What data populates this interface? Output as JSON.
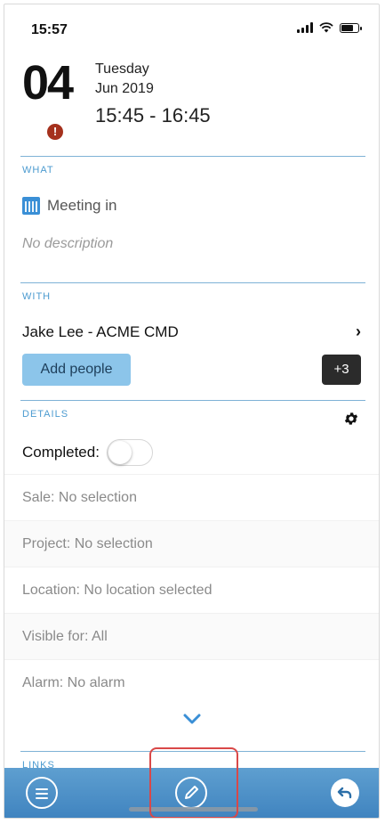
{
  "status_bar": {
    "time": "15:57"
  },
  "event": {
    "day": "04",
    "weekday": "Tuesday",
    "month_year": "Jun 2019",
    "time_range": "15:45 - 16:45",
    "alert_symbol": "!"
  },
  "what": {
    "label": "WHAT",
    "icon": "calendar-icon",
    "title": "Meeting in",
    "description": "No description"
  },
  "with": {
    "label": "WITH",
    "contact": "Jake Lee - ACME CMD",
    "chevron": "›",
    "add_people_label": "Add people",
    "extra_count": "+3"
  },
  "details": {
    "label": "DETAILS",
    "completed_label": "Completed:",
    "completed_value": false,
    "fields": [
      "Sale: No selection",
      "Project: No selection",
      "Location: No location selected",
      "Visible for: All",
      "Alarm: No alarm"
    ]
  },
  "links": {
    "label": "LINKS"
  },
  "bottom_bar": {
    "menu_icon": "menu-icon",
    "edit_icon": "edit-icon",
    "undo_icon": "undo-icon"
  },
  "colors": {
    "accent": "#4c9bd0",
    "section_line": "#7fb2d6",
    "add_people_bg": "#8cc5ea",
    "alert": "#a5311d",
    "bottom_bar": "#4f92c8",
    "highlight": "#d94848"
  }
}
